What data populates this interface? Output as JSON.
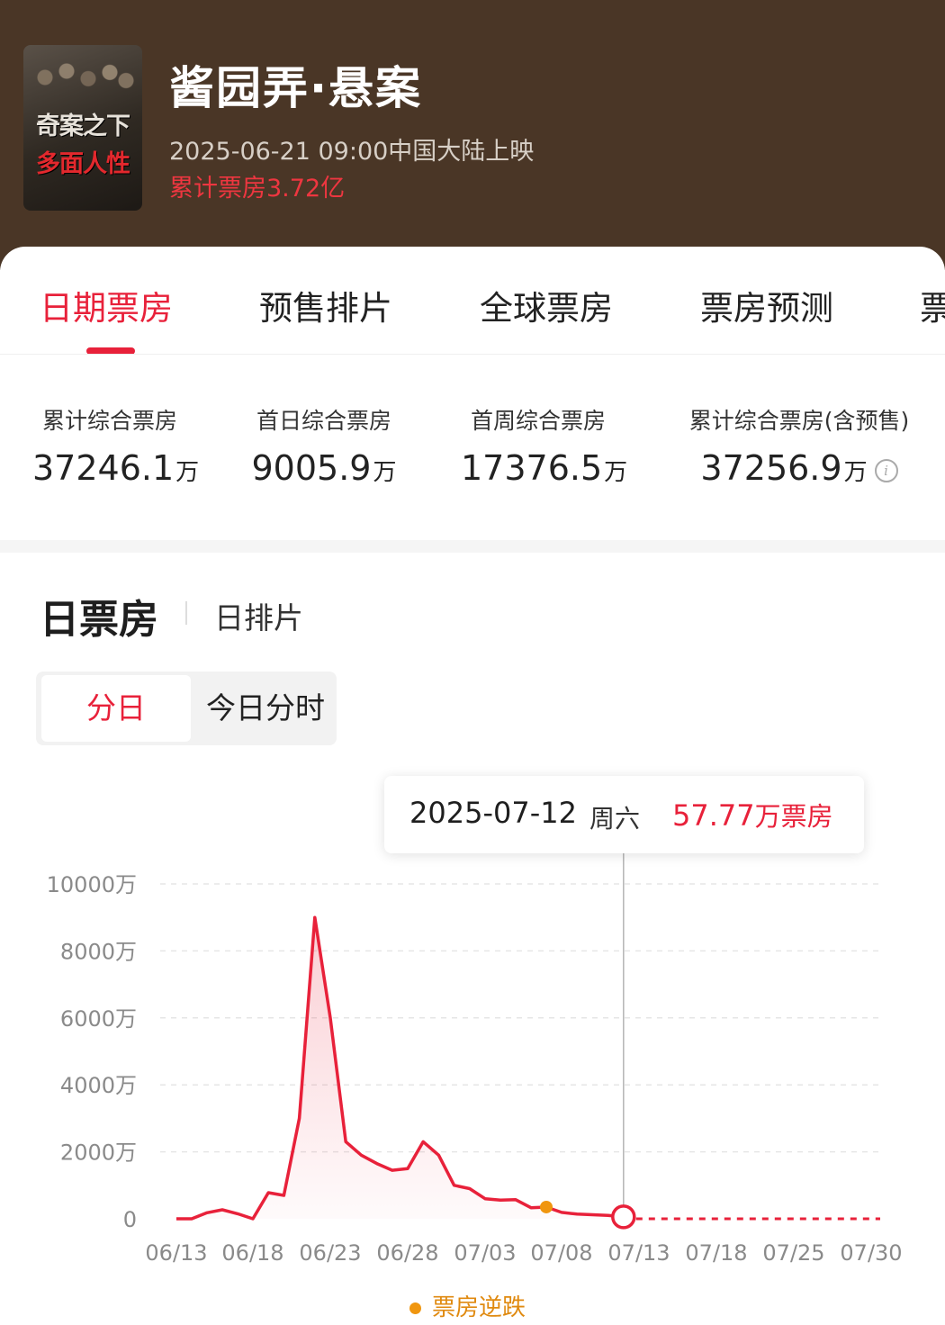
{
  "movie": {
    "title": "酱园弄·悬案",
    "release": "2025-06-21 09:00中国大陆上映",
    "total_box_office": "累计票房3.72亿",
    "poster_text_line1": "奇案之下",
    "poster_text_line2": "多面人性"
  },
  "tabs": [
    {
      "label": "日期票房",
      "active": true
    },
    {
      "label": "预售排片",
      "active": false
    },
    {
      "label": "全球票房",
      "active": false
    },
    {
      "label": "票房预测",
      "active": false
    },
    {
      "label": "票",
      "active": false
    }
  ],
  "stats": [
    {
      "label": "累计综合票房",
      "value": "37246.1",
      "unit": "万"
    },
    {
      "label": "首日综合票房",
      "value": "9005.9",
      "unit": "万"
    },
    {
      "label": "首周综合票房",
      "value": "17376.5",
      "unit": "万"
    },
    {
      "label": "累计综合票房(含预售)",
      "value": "37256.9",
      "unit": "万"
    }
  ],
  "section": {
    "title": "日票房",
    "alt_tab": "日排片",
    "seg_daily": "分日",
    "seg_hourly": "今日分时"
  },
  "tooltip": {
    "date": "2025-07-12",
    "weekday": "周六",
    "value": "57.77",
    "unit": "万票房"
  },
  "legend": {
    "label": "票房逆跌"
  },
  "colors": {
    "accent": "#e8213a",
    "header_bg": "#4a3626",
    "reversal": "#f0960f"
  },
  "chart_data": {
    "type": "line",
    "y_ticks": [
      "10000万",
      "8000万",
      "6000万",
      "4000万",
      "2000万",
      "0"
    ],
    "ylim": [
      0,
      10000
    ],
    "y_unit": "万",
    "x_tick_labels": [
      "06/13",
      "06/18",
      "06/23",
      "06/28",
      "07/03",
      "07/08",
      "07/13",
      "07/18",
      "07/25",
      "07/30"
    ],
    "series": [
      {
        "values": [
          {
            "date": "06/13",
            "value": 0
          },
          {
            "date": "06/14",
            "value": 0
          },
          {
            "date": "06/15",
            "value": 180
          },
          {
            "date": "06/16",
            "value": 270
          },
          {
            "date": "06/17",
            "value": 150
          },
          {
            "date": "06/18",
            "value": 0
          },
          {
            "date": "06/19",
            "value": 780
          },
          {
            "date": "06/20",
            "value": 700
          },
          {
            "date": "06/21",
            "value": 3000
          },
          {
            "date": "06/22",
            "value": 9000
          },
          {
            "date": "06/23",
            "value": 6000
          },
          {
            "date": "06/24",
            "value": 2300
          },
          {
            "date": "06/25",
            "value": 1900
          },
          {
            "date": "06/26",
            "value": 1650
          },
          {
            "date": "06/27",
            "value": 1450
          },
          {
            "date": "06/28",
            "value": 1500
          },
          {
            "date": "06/29",
            "value": 2300
          },
          {
            "date": "06/30",
            "value": 1900
          },
          {
            "date": "07/01",
            "value": 1000
          },
          {
            "date": "07/02",
            "value": 900
          },
          {
            "date": "07/03",
            "value": 600
          },
          {
            "date": "07/04",
            "value": 560
          },
          {
            "date": "07/05",
            "value": 570
          },
          {
            "date": "07/06",
            "value": 330
          },
          {
            "date": "07/07",
            "value": 350
          },
          {
            "date": "07/08",
            "value": 190
          },
          {
            "date": "07/09",
            "value": 140
          },
          {
            "date": "07/10",
            "value": 120
          },
          {
            "date": "07/11",
            "value": 100
          },
          {
            "date": "07/12",
            "value": 57.77
          }
        ]
      }
    ],
    "reversal_points": [
      {
        "date": "07/07",
        "value": 350
      }
    ],
    "selected_point": {
      "date": "07/12",
      "value": 57.77
    },
    "projection": {
      "from": "07/12",
      "to": "07/30",
      "value": 0,
      "style": "dashed"
    },
    "grid": true
  }
}
